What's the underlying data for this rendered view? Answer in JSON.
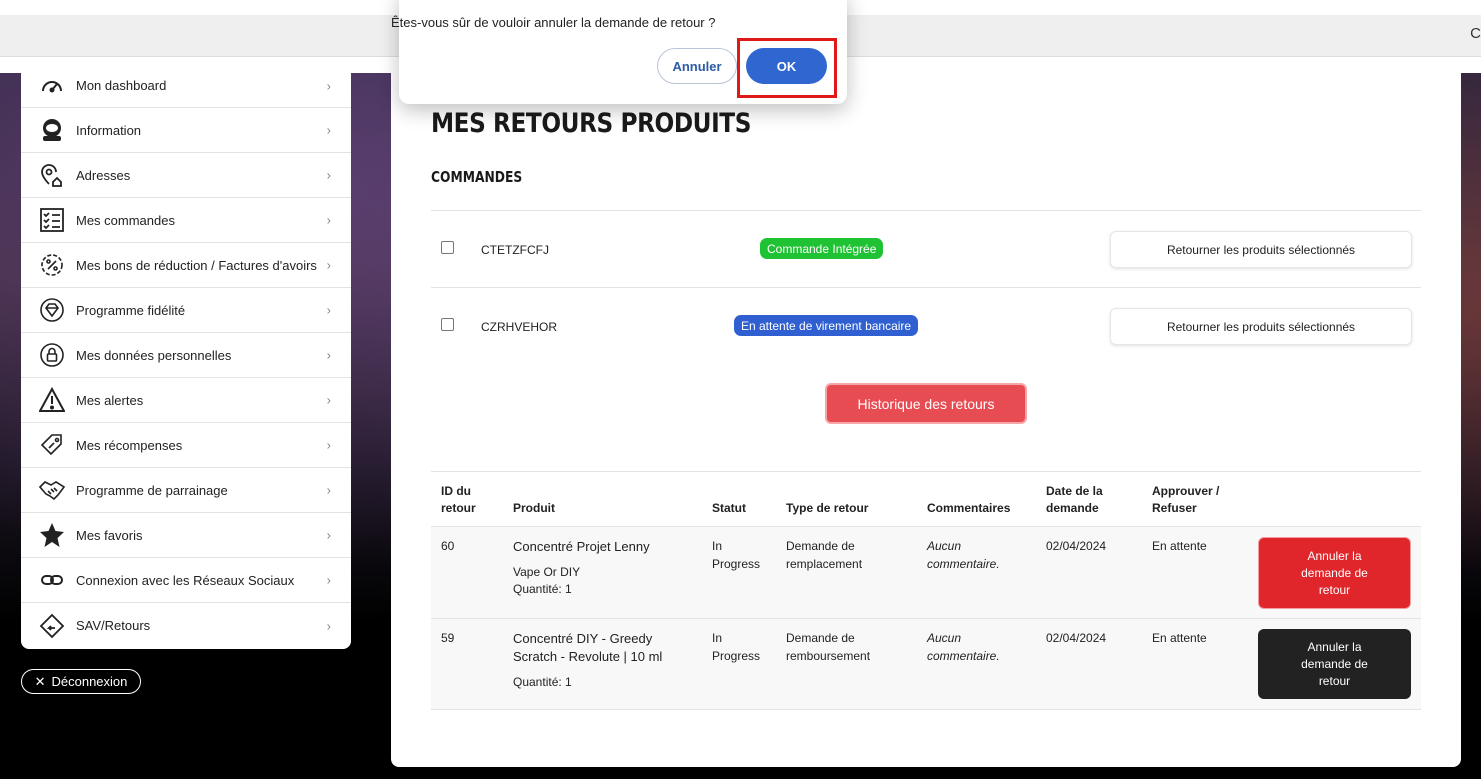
{
  "browser": {
    "corner_char": "C"
  },
  "dialog": {
    "message": "Êtes-vous sûr de vouloir annuler la demande de retour ?",
    "cancel_label": "Annuler",
    "ok_label": "OK"
  },
  "sidebar": {
    "items": [
      {
        "label": "Mon dashboard",
        "icon": "speedometer-icon"
      },
      {
        "label": "Information",
        "icon": "astronaut-icon"
      },
      {
        "label": "Adresses",
        "icon": "location-home-icon"
      },
      {
        "label": "Mes commandes",
        "icon": "checklist-icon"
      },
      {
        "label": "Mes bons de réduction / Factures d'avoirs",
        "icon": "discount-gear-icon"
      },
      {
        "label": "Programme fidélité",
        "icon": "diamond-icon"
      },
      {
        "label": "Mes données personnelles",
        "icon": "lock-icon"
      },
      {
        "label": "Mes alertes",
        "icon": "warning-icon"
      },
      {
        "label": "Mes récompenses",
        "icon": "tag-icon"
      },
      {
        "label": "Programme de parrainage",
        "icon": "handshake-icon"
      },
      {
        "label": "Mes favoris",
        "icon": "star-icon"
      },
      {
        "label": "Connexion avec les Réseaux Sociaux",
        "icon": "link-icon"
      },
      {
        "label": "SAV/Retours",
        "icon": "return-icon"
      }
    ],
    "chevron": "›",
    "logout_label": "Déconnexion"
  },
  "main": {
    "title": "MES RETOURS PRODUITS",
    "orders_title": "COMMANDES",
    "orders": [
      {
        "ref": "CTETZFCFJ",
        "status": "Commande Intégrée",
        "status_color": "#1fc232",
        "button": "Retourner les produits sélectionnés"
      },
      {
        "ref": "CZRHVEHOR",
        "status": "En attente de virement bancaire",
        "status_color": "#2f5fd0",
        "button": "Retourner les produits sélectionnés"
      }
    ],
    "history_button": "Historique des retours",
    "table": {
      "headers": {
        "id_line1": "ID du",
        "id_line2": "retour",
        "product": "Produit",
        "status": "Statut",
        "type": "Type de retour",
        "comments": "Commentaires",
        "date_line1": "Date de la",
        "date_line2": "demande",
        "approve_line1": "Approuver /",
        "approve_line2": "Refuser"
      },
      "rows": [
        {
          "id": "60",
          "product_line1": "Concentré Projet Lenny",
          "product_line2": "",
          "variant": "Vape Or DIY",
          "quantity": "Quantité: 1",
          "status_line1": "In",
          "status_line2": "Progress",
          "type_line1": "Demande de",
          "type_line2": "remplacement",
          "comment_line1": "Aucun",
          "comment_line2": "commentaire.",
          "date": "02/04/2024",
          "approval": "En attente",
          "action_line1": "Annuler la",
          "action_line2": "demande de",
          "action_line3": "retour"
        },
        {
          "id": "59",
          "product_line1": "Concentré DIY - Greedy",
          "product_line2": "Scratch - Revolute | 10 ml",
          "variant": "",
          "quantity": "Quantité: 1",
          "status_line1": "In",
          "status_line2": "Progress",
          "type_line1": "Demande de",
          "type_line2": "remboursement",
          "comment_line1": "Aucun",
          "comment_line2": "commentaire.",
          "date": "02/04/2024",
          "approval": "En attente",
          "action_line1": "Annuler la",
          "action_line2": "demande de",
          "action_line3": "retour"
        }
      ]
    }
  }
}
